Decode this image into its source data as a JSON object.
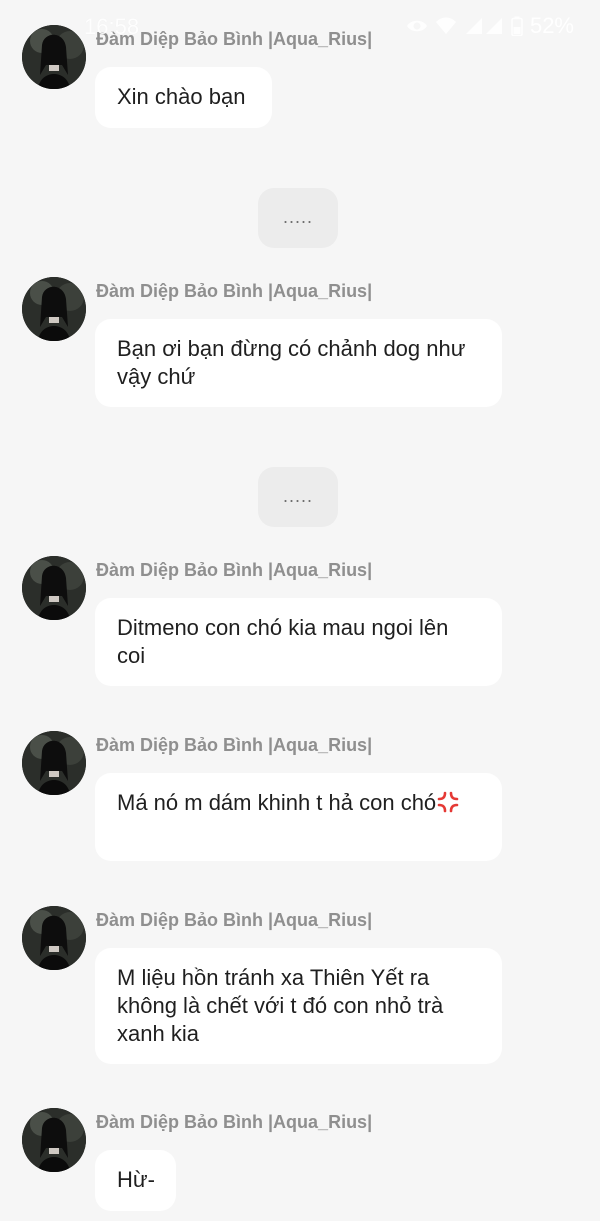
{
  "status_bar": {
    "time": "16:58",
    "battery": "52%"
  },
  "sender_name": "Đàm Diệp Bảo Bình |Aqua_Rius|",
  "messages": [
    {
      "sender": "Đàm Diệp Bảo Bình |Aqua_Rius|",
      "text": "Xin chào bạn"
    },
    {
      "sender": "Đàm Diệp Bảo Bình |Aqua_Rius|",
      "text": "Bạn ơi bạn đừng có chảnh dog như vậy chứ"
    },
    {
      "sender": "Đàm Diệp Bảo Bình |Aqua_Rius|",
      "text": "Ditmeno con chó kia mau ngoi lên coi"
    },
    {
      "sender": "Đàm Diệp Bảo Bình |Aqua_Rius|",
      "text": "Má nó m dám khinh t hả con chó"
    },
    {
      "sender": "Đàm Diệp Bảo Bình |Aqua_Rius|",
      "text": "M liệu hồn tránh xa Thiên Yết ra không là chết với t đó con nhỏ trà xanh kia"
    },
    {
      "sender": "Đàm Diệp Bảo Bình |Aqua_Rius|",
      "text": "Hừ-"
    }
  ],
  "replies": [
    {
      "text": "....."
    },
    {
      "text": "....."
    }
  ],
  "colors": {
    "background": "#f6f6f6",
    "bubble": "#ffffff",
    "reply_bubble": "#ececec",
    "sender_text": "#8f8f8f",
    "message_text": "#1f1f1f"
  }
}
